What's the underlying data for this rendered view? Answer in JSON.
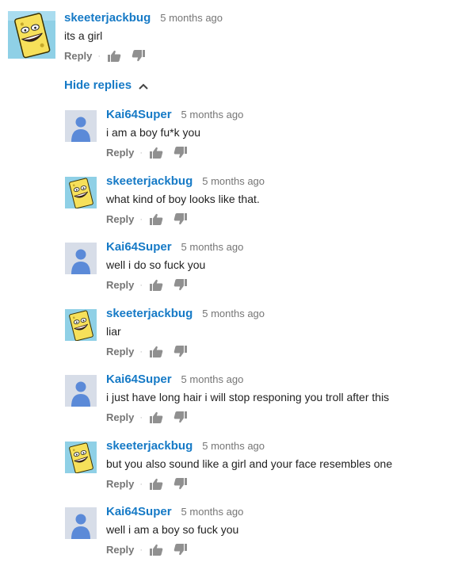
{
  "hide_replies_label": "Hide replies",
  "reply_label": "Reply",
  "separator": "·",
  "colors": {
    "author": "#167ac6",
    "meta": "#767676",
    "text": "#222222",
    "default_avatar_bg": "#d7dde8",
    "default_avatar_fg": "#5b8ad8",
    "sponge_yellow": "#f6e05a"
  },
  "top_comment": {
    "author": "skeeterjackbug",
    "time": "5 months ago",
    "text": "its a girl",
    "avatar": "spongebob-avatar"
  },
  "replies": [
    {
      "author": "Kai64Super",
      "time": "5 months ago",
      "text": "i am a boy fu*k you",
      "avatar": "default-avatar"
    },
    {
      "author": "skeeterjackbug",
      "time": "5 months ago",
      "text": "what kind of boy looks like that.",
      "avatar": "spongebob-avatar"
    },
    {
      "author": "Kai64Super",
      "time": "5 months ago",
      "text": "well i do so fuck you",
      "avatar": "default-avatar"
    },
    {
      "author": "skeeterjackbug",
      "time": "5 months ago",
      "text": "liar",
      "avatar": "spongebob-avatar"
    },
    {
      "author": "Kai64Super",
      "time": "5 months ago",
      "text": "i just have long hair i will stop responing you troll after this",
      "avatar": "default-avatar"
    },
    {
      "author": "skeeterjackbug",
      "time": "5 months ago",
      "text": "but you also sound like a girl and your face resembles one",
      "avatar": "spongebob-avatar"
    },
    {
      "author": "Kai64Super",
      "time": "5 months ago",
      "text": "well i am a boy so fuck you",
      "avatar": "default-avatar"
    }
  ]
}
